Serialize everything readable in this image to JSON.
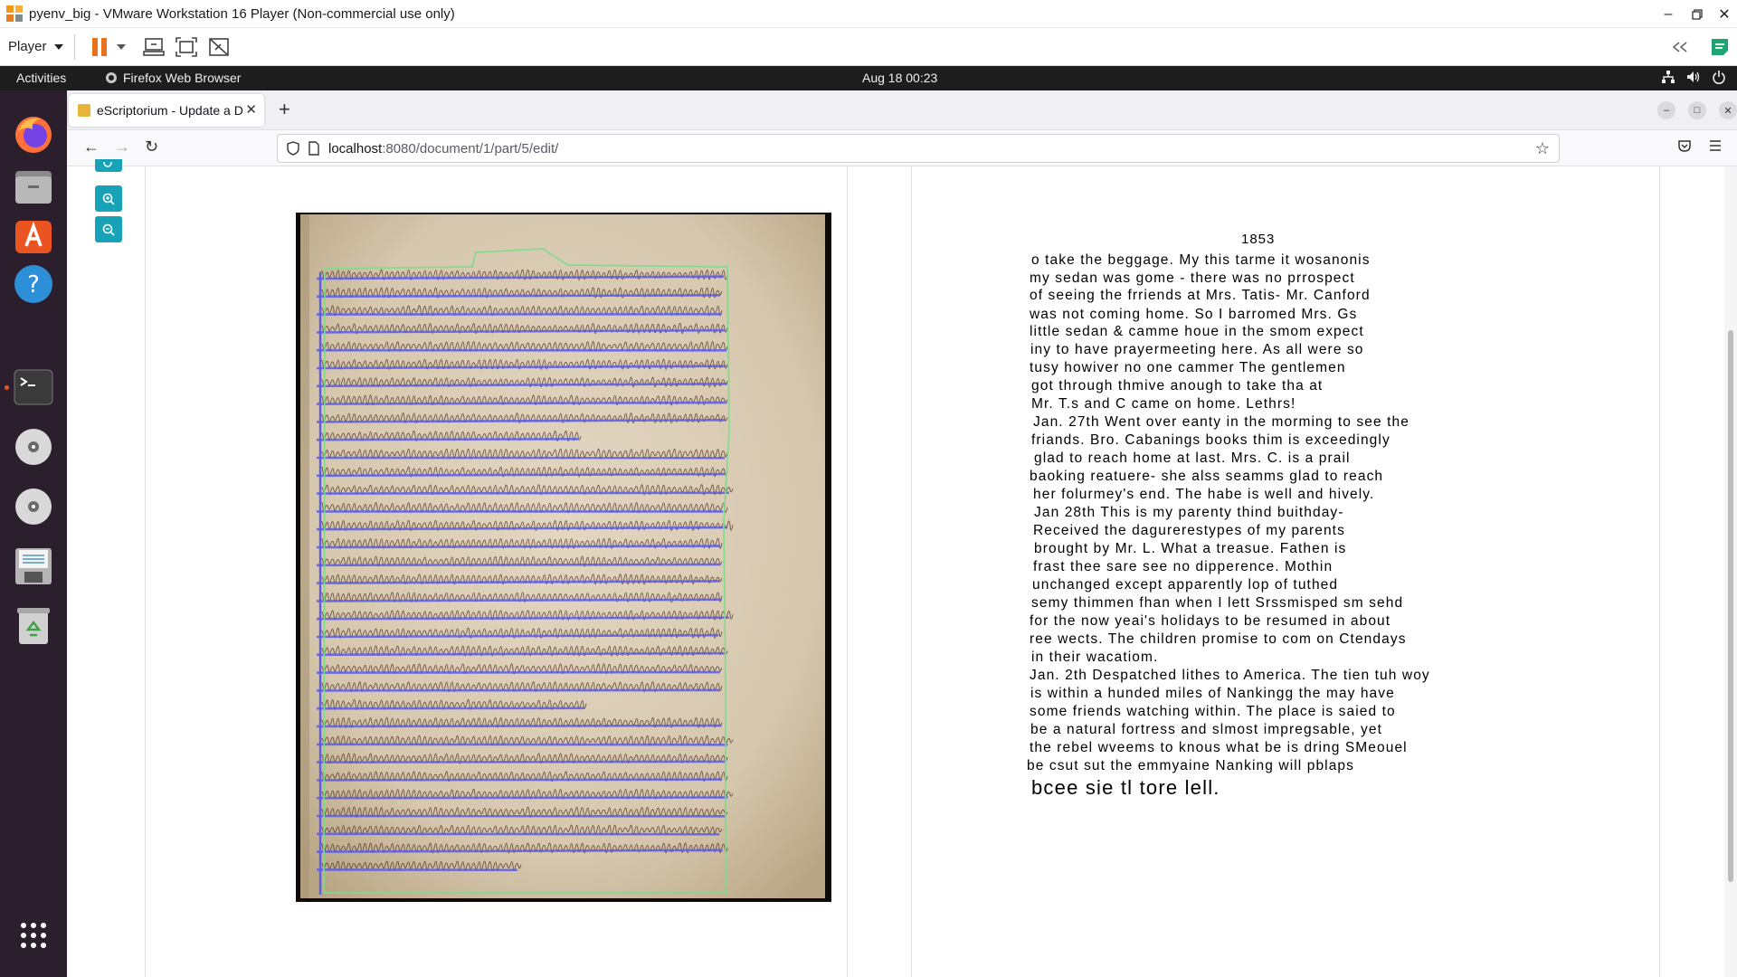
{
  "vm": {
    "title": "pyenv_big - VMware Workstation 16 Player (Non-commercial use only)",
    "player_menu": "Player"
  },
  "gnome": {
    "activities": "Activities",
    "app_name": "Firefox Web Browser",
    "clock": "Aug 18  00:23"
  },
  "browser": {
    "tab_title": "eScriptorium - Update a D",
    "url_host": "localhost",
    "url_rest": ":8080/document/1/part/5/edit/"
  },
  "transcription": {
    "lines": [
      "1853",
      "o take the beggage. My this tarme it wosanonis",
      "my sedan was gome - there was no prrospect",
      "of seeing the frriends at Mrs. Tatis- Mr. Canford",
      "was not coming home. So I barromed Mrs. Gs",
      "little sedan & camme houe in the smom expect",
      "iny to have prayermeeting here. As all were so",
      "tusy howiver no one cammer The gentlemen",
      "got through thmive anough to take tha at",
      "Mr. T.s and C came on home. Lethrs!",
      "Jan. 27th Went over eanty in the morming to see the",
      "friands. Bro. Cabanings books thim is exceedingly",
      "glad to reach home at last. Mrs. C. is a prail",
      "baoking reatuere- she alss seamms glad to reach",
      "her folurmey's end. The habe is well and hively.",
      "Jan 28th This is my parenty thind buithday-",
      "Received the dagurerestypes of my parents",
      "brought by Mr. L. What a treasue. Fathen is",
      "frast thee sare see no dipperence. Mothin",
      "unchanged except apparently lop of tuthed",
      "semy thimmen fhan when I lett Srssmisped sm sehd",
      "for the now yeai's holidays to be resumed in about",
      "ree wects. The children promise to com on Ctendays",
      "in their wacatiom.",
      "Jan. 2th Despatched lithes to America. The tien tuh woy",
      "is within a hunded miles of Nankingg the may have",
      "some friends watching within. The place is saied to",
      "be a natural fortress and slmost impregsable, yet",
      "the rebel wveems to knous what be is dring SMeouel",
      "be csut sut the emmyaine Nanking will pblaps",
      "bcee sie tl tore lell."
    ]
  }
}
